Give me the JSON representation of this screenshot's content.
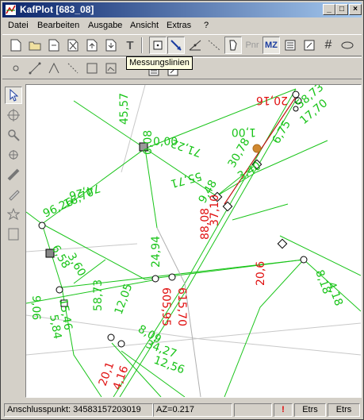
{
  "window": {
    "title": "KafPlot [683_08]"
  },
  "menu": [
    "Datei",
    "Bearbeiten",
    "Ausgabe",
    "Ansicht",
    "Extras",
    "?"
  ],
  "toolbar1": {
    "pnr_label": "Pnr",
    "mz_label": "MZ",
    "text_tool": "T"
  },
  "tooltip": "Messungslinien",
  "map": {
    "green_labels": [
      "45,57",
      "0,08",
      "0,00",
      "74,26",
      "55,71",
      "71,22",
      "96,26",
      "16,70",
      "6,58",
      "3,60",
      "9,06",
      "24,94",
      "58,73",
      "12,05",
      "15,46",
      "5,84",
      "8,09",
      "34,27",
      "12,56",
      "3,40",
      "8,18",
      "4,18",
      "58,73",
      "17,70",
      "1,00",
      "6,75",
      "9,48",
      "30,78"
    ],
    "red_labels": [
      "20,16",
      "88,08",
      "20,6",
      "605,95",
      "615,70",
      "37,10",
      "20,1",
      "4,16"
    ]
  },
  "status": {
    "anschluss": "Anschlusspunkt: 34583157203019",
    "az": "AZ=0.217",
    "alert": "!",
    "etrs1": "Etrs",
    "etrs2": "Etrs"
  }
}
